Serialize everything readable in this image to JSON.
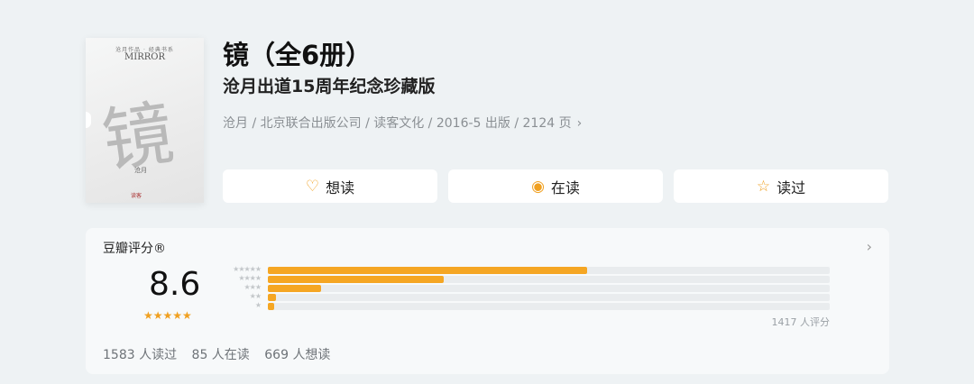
{
  "book": {
    "title": "镜（全6册）",
    "subtitle": "沧月出道15周年纪念珍藏版",
    "meta": "沧月 / 北京联合出版公司 / 读客文化 / 2016-5 出版 / 2124 页",
    "meta_chevron": "›"
  },
  "cover": {
    "top_text": "沧月作品 · 经典书系",
    "logo": "MIRROR",
    "big_char": "镜",
    "author": "沧月",
    "publisher": "读客"
  },
  "actions": [
    {
      "label": "想读",
      "icon": "heart-plus-icon",
      "glyph": "♡"
    },
    {
      "label": "在读",
      "icon": "reading-circle-icon",
      "glyph": "◉"
    },
    {
      "label": "读过",
      "icon": "star-outline-icon",
      "glyph": "☆"
    }
  ],
  "rating": {
    "label": "豆瓣评分®",
    "score": "8.6",
    "stars_glyph": "★★★★★",
    "count_text": "1417 人评分",
    "arrow": "›",
    "distribution": [
      {
        "stars": "★★★★★",
        "fraction": 0.568
      },
      {
        "stars": "★★★★",
        "fraction": 0.313
      },
      {
        "stars": "★★★",
        "fraction": 0.094
      },
      {
        "stars": "★★",
        "fraction": 0.015
      },
      {
        "stars": "★",
        "fraction": 0.012
      }
    ]
  },
  "stats": {
    "read": "1583 人读过",
    "reading": "85 人在读",
    "want": "669 人想读"
  },
  "colors": {
    "accent": "#f5a623",
    "background": "#eef2f4",
    "card": "#f7f9fa"
  }
}
